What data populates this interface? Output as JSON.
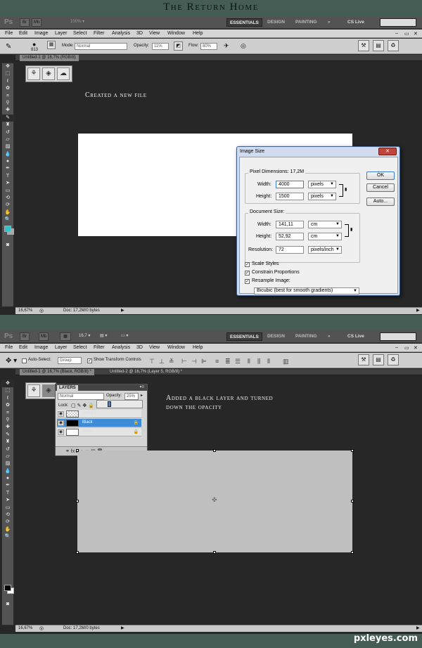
{
  "page": {
    "title": "The Return Home",
    "watermark": "pxleyes.com"
  },
  "app": {
    "logo": "Ps",
    "workspaces": [
      "ESSENTIALS",
      "DESIGN",
      "PAINTING",
      "»"
    ],
    "cs_live": "CS Live",
    "menus": [
      "File",
      "Edit",
      "Image",
      "Layer",
      "Select",
      "Filter",
      "Analysis",
      "3D",
      "View",
      "Window",
      "Help"
    ],
    "zoom_box_top": "16,7"
  },
  "shot1": {
    "options": {
      "brush_size": "813",
      "mode_label": "Mode:",
      "mode_value": "Normal",
      "opacity_label": "Opacity:",
      "opacity_value": "11%",
      "flow_label": "Flow:",
      "flow_value": "80%"
    },
    "tab": "Untitled-1 @ 16,7% (RGB/8)",
    "caption": "Created a new file",
    "status": {
      "zoom": "16,67%",
      "doc": "Doc: 17,2M/0 bytes"
    },
    "dialog": {
      "title": "Image Size",
      "close": "✕",
      "pixel_dimensions": "Pixel Dimensions:",
      "pixel_size": "17,2M",
      "width_label": "Width:",
      "width_value": "4000",
      "width_unit": "pixels",
      "height_label": "Height:",
      "height_value": "1500",
      "height_unit": "pixels",
      "document_size": "Document Size:",
      "doc_width_label": "Width:",
      "doc_width_value": "141,11",
      "doc_width_unit": "cm",
      "doc_height_label": "Height:",
      "doc_height_value": "52,92",
      "doc_height_unit": "cm",
      "resolution_label": "Resolution:",
      "resolution_value": "72",
      "resolution_unit": "pixels/inch",
      "scale_styles": "Scale Styles",
      "constrain": "Constrain Proportions",
      "resample": "Resample Image:",
      "resample_method": "Bicubic (best for smooth gradients)",
      "ok": "OK",
      "cancel": "Cancel",
      "auto": "Auto..."
    }
  },
  "shot2": {
    "options": {
      "auto_select": "Auto-Select:",
      "auto_select_value": "Group",
      "show_transform": "Show Transform Controls"
    },
    "tabs": [
      "Untitled-1 @ 16,7% (Black, RGB/8) *",
      "Untitled-2 @ 16,7% (Layer 5, RGB/8) *"
    ],
    "caption": "Added a black layer and turned down the opacity",
    "status": {
      "zoom": "16,67%",
      "doc": "Doc: 17,2M/0 bytes"
    },
    "layers": {
      "tab": "LAYERS",
      "blend_mode": "Normal",
      "opacity_label": "Opacity:",
      "opacity_value": "25%",
      "lock_label": "Lock:",
      "rows": [
        {
          "name": "Layer 1",
          "selected": false
        },
        {
          "name": "Black",
          "selected": true
        },
        {
          "name": "White",
          "selected": false
        }
      ],
      "footer_icons": "⚭ fx ◙ ◐ ▭ ▤ 🗑"
    },
    "opacity_fraction": 0.25
  },
  "colors": {
    "accent_cyan": "#33c2c9",
    "selection_blue": "#3e8cd8",
    "workspace_bg": "#272727"
  }
}
